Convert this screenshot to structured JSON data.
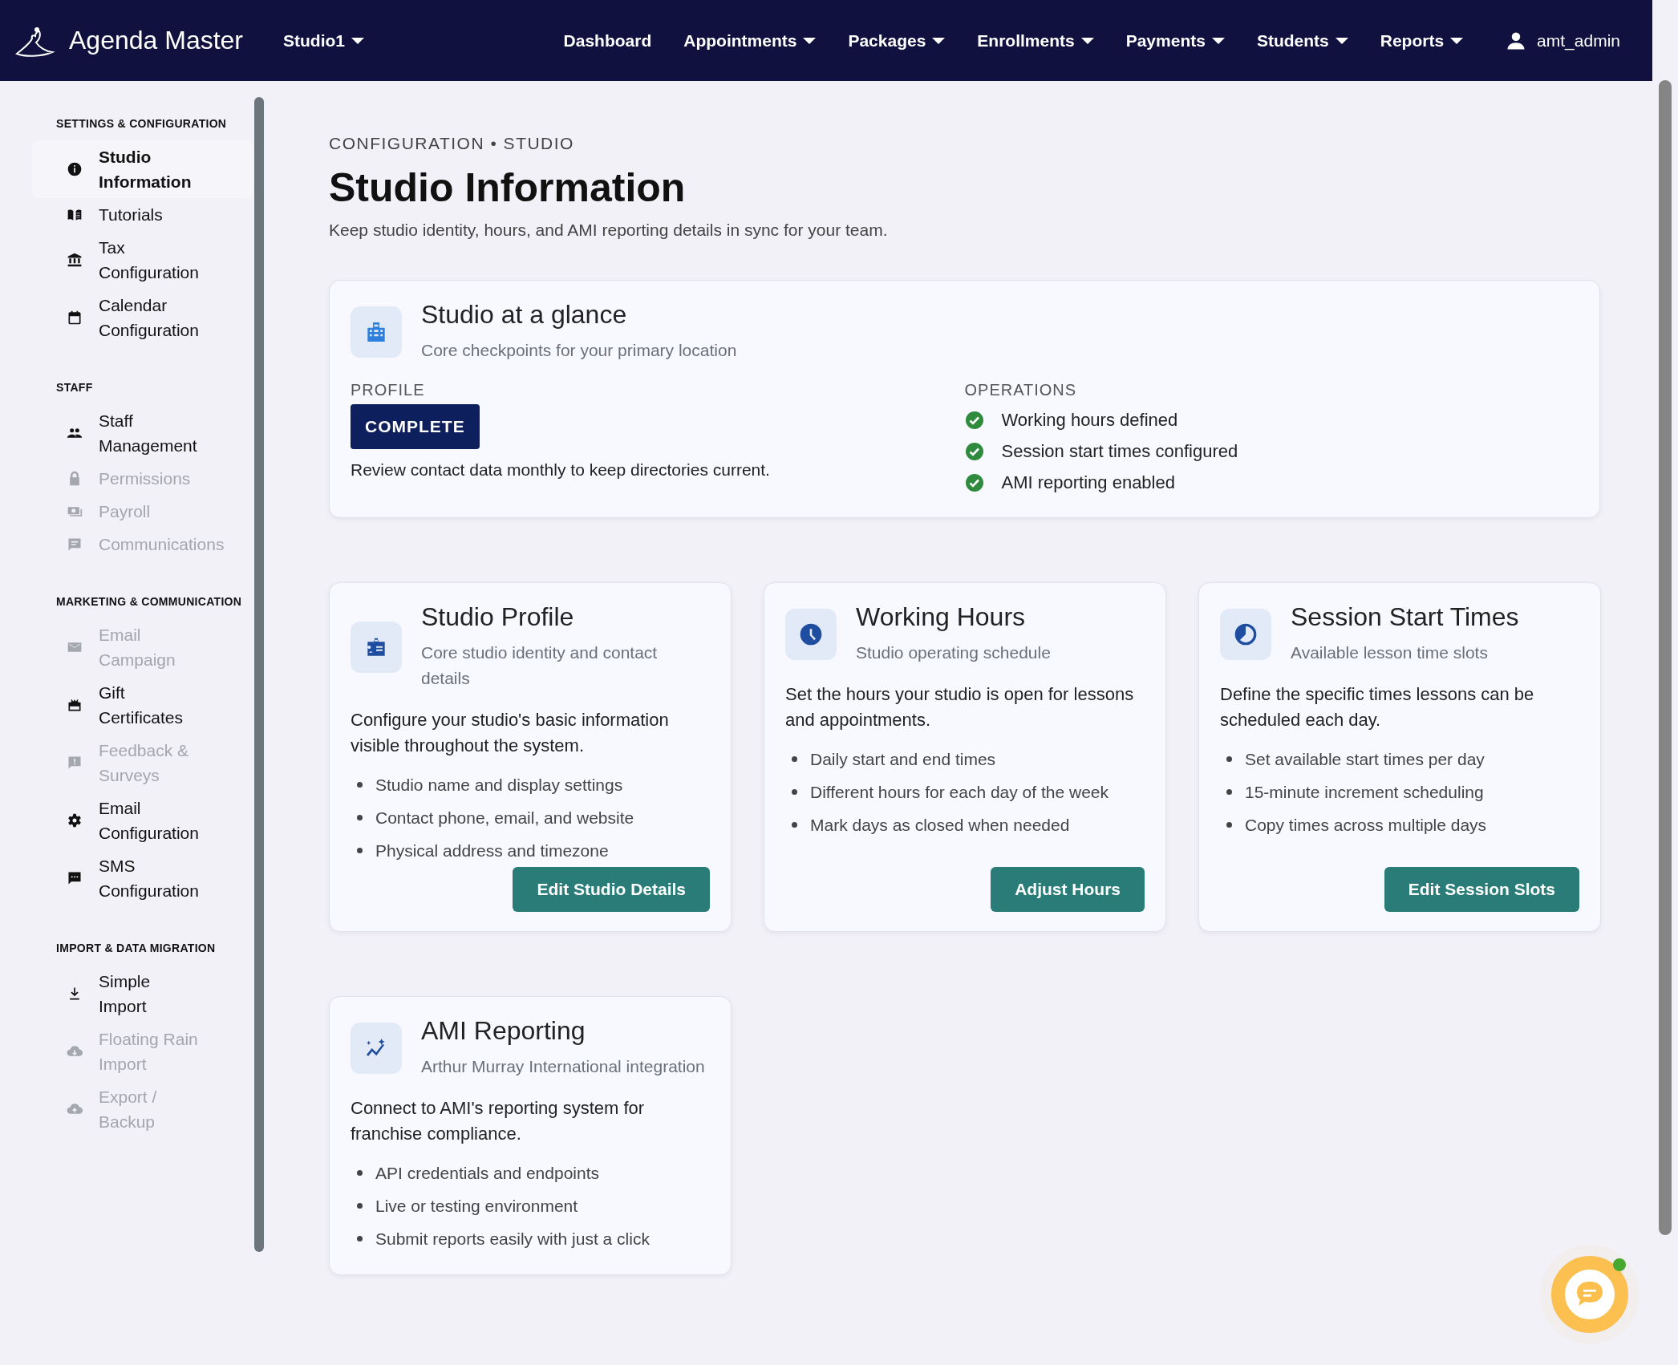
{
  "nav": {
    "brand": "Agenda Master",
    "studio": "Studio1",
    "items": [
      {
        "label": "Dashboard",
        "has_menu": false
      },
      {
        "label": "Appointments",
        "has_menu": true
      },
      {
        "label": "Packages",
        "has_menu": true
      },
      {
        "label": "Enrollments",
        "has_menu": true
      },
      {
        "label": "Payments",
        "has_menu": true
      },
      {
        "label": "Students",
        "has_menu": true
      },
      {
        "label": "Reports",
        "has_menu": true
      }
    ],
    "user": "amt_admin"
  },
  "sidebar": {
    "sections": [
      {
        "heading": "SETTINGS & CONFIGURATION",
        "items": [
          {
            "label": "Studio Information",
            "disabled": false,
            "selected": true
          },
          {
            "label": "Tutorials",
            "disabled": false,
            "selected": false
          },
          {
            "label": "Tax Configuration",
            "disabled": false,
            "selected": false
          },
          {
            "label": "Calendar Configuration",
            "disabled": false,
            "selected": false
          }
        ]
      },
      {
        "heading": "STAFF",
        "items": [
          {
            "label": "Staff Management",
            "disabled": false,
            "selected": false
          },
          {
            "label": "Permissions",
            "disabled": true,
            "selected": false
          },
          {
            "label": "Payroll",
            "disabled": true,
            "selected": false
          },
          {
            "label": "Communications",
            "disabled": true,
            "selected": false
          }
        ]
      },
      {
        "heading": "MARKETING & COMMUNICATION",
        "items": [
          {
            "label": "Email Campaign",
            "disabled": true,
            "selected": false
          },
          {
            "label": "Gift Certificates",
            "disabled": false,
            "selected": false
          },
          {
            "label": "Feedback & Surveys",
            "disabled": true,
            "selected": false
          },
          {
            "label": "Email Configuration",
            "disabled": false,
            "selected": false
          },
          {
            "label": "SMS Configuration",
            "disabled": false,
            "selected": false
          }
        ]
      },
      {
        "heading": "IMPORT & DATA MIGRATION",
        "items": [
          {
            "label": "Simple Import",
            "disabled": false,
            "selected": false
          },
          {
            "label": "Floating Rain Import",
            "disabled": true,
            "selected": false
          },
          {
            "label": "Export / Backup",
            "disabled": true,
            "selected": false
          }
        ]
      }
    ]
  },
  "page": {
    "breadcrumb": "CONFIGURATION • STUDIO",
    "title": "Studio Information",
    "subtitle": "Keep studio identity, hours, and AMI reporting details in sync for your team."
  },
  "glance": {
    "title": "Studio at a glance",
    "subtitle": "Core checkpoints for your primary location",
    "profile": {
      "label": "PROFILE",
      "status": "COMPLETE",
      "note": "Review contact data monthly to keep directories current."
    },
    "operations": {
      "label": "OPERATIONS",
      "items": [
        {
          "label": "Working hours defined",
          "done": true
        },
        {
          "label": "Session start times configured",
          "done": true
        },
        {
          "label": "AMI reporting enabled",
          "done": true
        }
      ]
    }
  },
  "cards": [
    {
      "title": "Studio Profile",
      "subtitle": "Core studio identity and contact details",
      "description": "Configure your studio's basic information visible throughout the system.",
      "bullets": [
        "Studio name and display settings",
        "Contact phone, email, and website",
        "Physical address and timezone"
      ],
      "button": "Edit Studio Details"
    },
    {
      "title": "Working Hours",
      "subtitle": "Studio operating schedule",
      "description": "Set the hours your studio is open for lessons and appointments.",
      "bullets": [
        "Daily start and end times",
        "Different hours for each day of the week",
        "Mark days as closed when needed"
      ],
      "button": "Adjust Hours"
    },
    {
      "title": "Session Start Times",
      "subtitle": "Available lesson time slots",
      "description": "Define the specific times lessons can be scheduled each day.",
      "bullets": [
        "Set available start times per day",
        "15-minute increment scheduling",
        "Copy times across multiple days"
      ],
      "button": "Edit Session Slots"
    },
    {
      "title": "AMI Reporting",
      "subtitle": "Arthur Murray International integration",
      "description": "Connect to AMI's reporting system for franchise compliance.",
      "bullets": [
        "API credentials and endpoints",
        "Live or testing environment",
        "Submit reports easily with just a click"
      ]
    }
  ],
  "chat": {
    "unread": true
  }
}
